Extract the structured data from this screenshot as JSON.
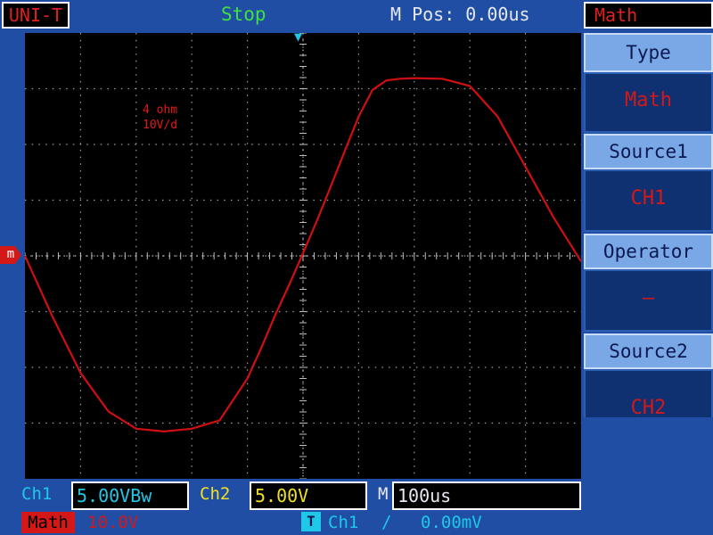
{
  "header": {
    "brand": "UNI-T",
    "run_status": "Stop",
    "m_pos": "M Pos: 0.00us"
  },
  "menu": {
    "title": "Math",
    "items": [
      {
        "label": "Type",
        "value": "Math"
      },
      {
        "label": "Source1",
        "value": "CH1"
      },
      {
        "label": "Operator",
        "value": "—"
      },
      {
        "label": "Source2",
        "value": "CH2"
      }
    ]
  },
  "annotation": {
    "line1": "4 ohm",
    "line2": "10V/d"
  },
  "markers": {
    "trigger_pos_glyph": "▼",
    "math_channel_marker": "m"
  },
  "bottom": {
    "ch1_label": "Ch1",
    "ch1_scale": "5.00VBw",
    "ch2_label": "Ch2",
    "ch2_scale": "5.00V",
    "timebase_label": "M",
    "timebase": "100us",
    "math_label": "Math",
    "math_scale": "10.0V",
    "trigger_icon": "T",
    "trigger_source": "Ch1",
    "trigger_edge": "∕",
    "trigger_level": "0.00mV"
  },
  "colors": {
    "background": "#1f4ea4",
    "trace": "#d01010",
    "ch1": "#1fc8e8",
    "ch2": "#f0e020",
    "status": "#3fe03f"
  },
  "chart_data": {
    "type": "line",
    "title": "",
    "xlabel": "",
    "ylabel": "",
    "grid": true,
    "xlim": [
      -500,
      500
    ],
    "ylim": [
      -40,
      40
    ],
    "series": [
      {
        "x": [
          -500,
          -450,
          -400,
          -350,
          -300,
          -250,
          -200,
          -150,
          -100,
          -75,
          -50,
          -25,
          0,
          25,
          50,
          75,
          100,
          125,
          150,
          175,
          200,
          250,
          300,
          350,
          400,
          450,
          500
        ],
        "y": [
          0,
          -11,
          -21,
          -27.9,
          -31,
          -31.5,
          -31,
          -29.5,
          -22,
          -16.5,
          -10.6,
          -5.2,
          0.5,
          6.3,
          12.5,
          18.8,
          25,
          29.8,
          31.5,
          31.8,
          31.9,
          31.8,
          30.5,
          25,
          16,
          7,
          -1
        ]
      }
    ]
  }
}
